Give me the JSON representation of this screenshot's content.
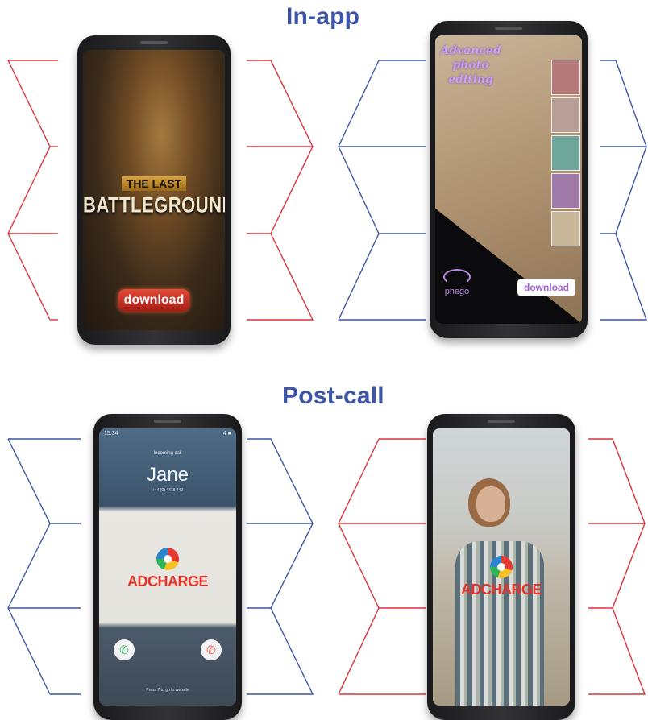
{
  "sections": {
    "in_app": "In-app",
    "post_call": "Post-call"
  },
  "colors": {
    "heading": "#3d55a4",
    "red_chevron": "#d8343a",
    "blue_chevron": "#3d55a4"
  },
  "game_ad": {
    "tag_small": "THE LAST",
    "tag_big": "BATTLEGROUND",
    "download": "download"
  },
  "photo_ad": {
    "title": "Advanced photo editing",
    "brand": "phego",
    "download": "download"
  },
  "call_screen": {
    "time": "15:34",
    "battery": "4 ■",
    "incoming": "Incoming call",
    "caller": "Jane",
    "number": "+44 (0) 4418 742",
    "brand": "ADCHARGE",
    "answer_icon": "phone-answer-icon",
    "decline_icon": "phone-decline-icon",
    "hint": "Press 7 to go to website"
  },
  "woman_ad": {
    "brand": "ADCHARGE"
  }
}
